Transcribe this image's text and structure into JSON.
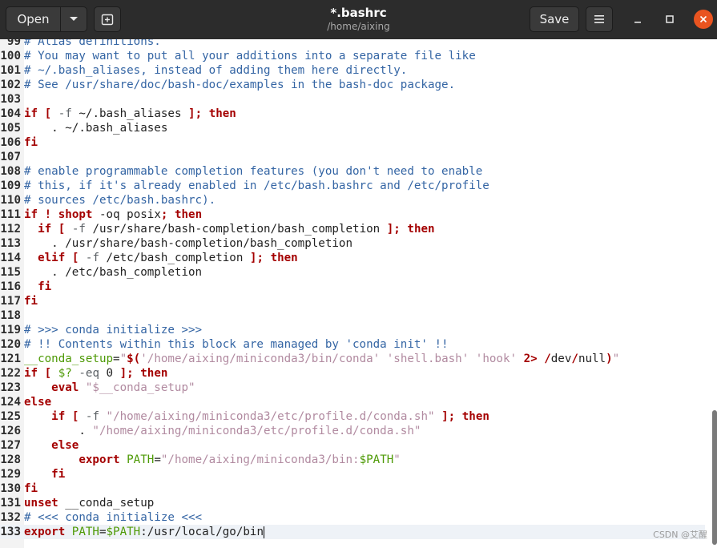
{
  "header": {
    "open_label": "Open",
    "title": "*.bashrc",
    "subtitle": "/home/aixing",
    "save_label": "Save",
    "icons": {
      "open_dropdown": "chevron-down-icon",
      "new_tab": "new-document-icon",
      "menu": "hamburger-menu-icon",
      "minimize": "minimize-icon",
      "maximize": "maximize-icon",
      "close": "close-icon"
    }
  },
  "editor": {
    "current_line": 133,
    "lines": [
      {
        "n": "99",
        "segs": [
          [
            "comment",
            "# Alias definitions."
          ]
        ]
      },
      {
        "n": "100",
        "segs": [
          [
            "comment",
            "# You may want to put all your additions into a separate file like"
          ]
        ]
      },
      {
        "n": "101",
        "segs": [
          [
            "comment",
            "# ~/.bash_aliases, instead of adding them here directly."
          ]
        ]
      },
      {
        "n": "102",
        "segs": [
          [
            "comment",
            "# See /usr/share/doc/bash-doc/examples in the bash-doc package."
          ]
        ]
      },
      {
        "n": "103",
        "segs": []
      },
      {
        "n": "104",
        "segs": [
          [
            "kw",
            "if"
          ],
          [
            "def",
            " "
          ],
          [
            "kw",
            "["
          ],
          [
            "def",
            " "
          ],
          [
            "op",
            "-f"
          ],
          [
            "def",
            " ~/.bash_aliases "
          ],
          [
            "kw",
            "];"
          ],
          [
            "def",
            " "
          ],
          [
            "kw",
            "then"
          ]
        ]
      },
      {
        "n": "105",
        "segs": [
          [
            "def",
            "    . ~/.bash_aliases"
          ]
        ]
      },
      {
        "n": "106",
        "segs": [
          [
            "kw",
            "fi"
          ]
        ]
      },
      {
        "n": "107",
        "segs": []
      },
      {
        "n": "108",
        "segs": [
          [
            "comment",
            "# enable programmable completion features (you don't need to enable"
          ]
        ]
      },
      {
        "n": "109",
        "segs": [
          [
            "comment",
            "# this, if it's already enabled in /etc/bash.bashrc and /etc/profile"
          ]
        ]
      },
      {
        "n": "110",
        "segs": [
          [
            "comment",
            "# sources /etc/bash.bashrc)."
          ]
        ]
      },
      {
        "n": "111",
        "segs": [
          [
            "kw",
            "if"
          ],
          [
            "def",
            " "
          ],
          [
            "kw",
            "!"
          ],
          [
            "def",
            " "
          ],
          [
            "kw",
            "shopt"
          ],
          [
            "def",
            " -oq posix"
          ],
          [
            "kw",
            ";"
          ],
          [
            "def",
            " "
          ],
          [
            "kw",
            "then"
          ]
        ]
      },
      {
        "n": "112",
        "segs": [
          [
            "def",
            "  "
          ],
          [
            "kw",
            "if"
          ],
          [
            "def",
            " "
          ],
          [
            "kw",
            "["
          ],
          [
            "def",
            " "
          ],
          [
            "op",
            "-f"
          ],
          [
            "def",
            " /usr/share/bash-completion/bash_completion "
          ],
          [
            "kw",
            "];"
          ],
          [
            "def",
            " "
          ],
          [
            "kw",
            "then"
          ]
        ]
      },
      {
        "n": "113",
        "segs": [
          [
            "def",
            "    . /usr/share/bash-completion/bash_completion"
          ]
        ]
      },
      {
        "n": "114",
        "segs": [
          [
            "def",
            "  "
          ],
          [
            "kw",
            "elif"
          ],
          [
            "def",
            " "
          ],
          [
            "kw",
            "["
          ],
          [
            "def",
            " "
          ],
          [
            "op",
            "-f"
          ],
          [
            "def",
            " /etc/bash_completion "
          ],
          [
            "kw",
            "];"
          ],
          [
            "def",
            " "
          ],
          [
            "kw",
            "then"
          ]
        ]
      },
      {
        "n": "115",
        "segs": [
          [
            "def",
            "    . /etc/bash_completion"
          ]
        ]
      },
      {
        "n": "116",
        "segs": [
          [
            "def",
            "  "
          ],
          [
            "kw",
            "fi"
          ]
        ]
      },
      {
        "n": "117",
        "segs": [
          [
            "kw",
            "fi"
          ]
        ]
      },
      {
        "n": "118",
        "segs": []
      },
      {
        "n": "119",
        "segs": [
          [
            "comment",
            "# >>> conda initialize >>>"
          ]
        ]
      },
      {
        "n": "120",
        "segs": [
          [
            "comment",
            "# !! Contents within this block are managed by 'conda init' !!"
          ]
        ]
      },
      {
        "n": "121",
        "segs": [
          [
            "var",
            "__conda_setup"
          ],
          [
            "def",
            "="
          ],
          [
            "str",
            "\""
          ],
          [
            "kw",
            "$("
          ],
          [
            "str",
            "'/home/aixing/miniconda3/bin/conda' 'shell.bash' 'hook' "
          ],
          [
            "kw",
            "2>"
          ],
          [
            "def",
            " "
          ],
          [
            "kw",
            "/"
          ],
          [
            "def",
            "dev"
          ],
          [
            "kw",
            "/"
          ],
          [
            "def",
            "null"
          ],
          [
            "kw",
            ")"
          ],
          [
            "str",
            "\""
          ]
        ]
      },
      {
        "n": "122",
        "segs": [
          [
            "kw",
            "if"
          ],
          [
            "def",
            " "
          ],
          [
            "kw",
            "["
          ],
          [
            "def",
            " "
          ],
          [
            "var",
            "$?"
          ],
          [
            "def",
            " "
          ],
          [
            "op",
            "-eq"
          ],
          [
            "def",
            " 0 "
          ],
          [
            "kw",
            "];"
          ],
          [
            "def",
            " "
          ],
          [
            "kw",
            "then"
          ]
        ]
      },
      {
        "n": "123",
        "segs": [
          [
            "def",
            "    "
          ],
          [
            "kw",
            "eval"
          ],
          [
            "def",
            " "
          ],
          [
            "str",
            "\"$__conda_setup\""
          ]
        ]
      },
      {
        "n": "124",
        "segs": [
          [
            "kw",
            "else"
          ]
        ]
      },
      {
        "n": "125",
        "segs": [
          [
            "def",
            "    "
          ],
          [
            "kw",
            "if"
          ],
          [
            "def",
            " "
          ],
          [
            "kw",
            "["
          ],
          [
            "def",
            " "
          ],
          [
            "op",
            "-f"
          ],
          [
            "def",
            " "
          ],
          [
            "str",
            "\"/home/aixing/miniconda3/etc/profile.d/conda.sh\""
          ],
          [
            "def",
            " "
          ],
          [
            "kw",
            "];"
          ],
          [
            "def",
            " "
          ],
          [
            "kw",
            "then"
          ]
        ]
      },
      {
        "n": "126",
        "segs": [
          [
            "def",
            "        . "
          ],
          [
            "str",
            "\"/home/aixing/miniconda3/etc/profile.d/conda.sh\""
          ]
        ]
      },
      {
        "n": "127",
        "segs": [
          [
            "def",
            "    "
          ],
          [
            "kw",
            "else"
          ]
        ]
      },
      {
        "n": "128",
        "segs": [
          [
            "def",
            "        "
          ],
          [
            "kw",
            "export"
          ],
          [
            "def",
            " "
          ],
          [
            "var",
            "PATH"
          ],
          [
            "def",
            "="
          ],
          [
            "str",
            "\"/home/aixing/miniconda3/bin:"
          ],
          [
            "var",
            "$PATH"
          ],
          [
            "str",
            "\""
          ]
        ]
      },
      {
        "n": "129",
        "segs": [
          [
            "def",
            "    "
          ],
          [
            "kw",
            "fi"
          ]
        ]
      },
      {
        "n": "130",
        "segs": [
          [
            "kw",
            "fi"
          ]
        ]
      },
      {
        "n": "131",
        "segs": [
          [
            "kw",
            "unset"
          ],
          [
            "def",
            " __conda_setup"
          ]
        ]
      },
      {
        "n": "132",
        "segs": [
          [
            "comment",
            "# <<< conda initialize <<<"
          ]
        ]
      },
      {
        "n": "133",
        "segs": [
          [
            "kw",
            "export"
          ],
          [
            "def",
            " "
          ],
          [
            "var",
            "PATH"
          ],
          [
            "def",
            "="
          ],
          [
            "var",
            "$PATH"
          ],
          [
            "def",
            ":/usr/local/go/bin"
          ]
        ]
      }
    ]
  },
  "watermark": "CSDN @艾醒"
}
